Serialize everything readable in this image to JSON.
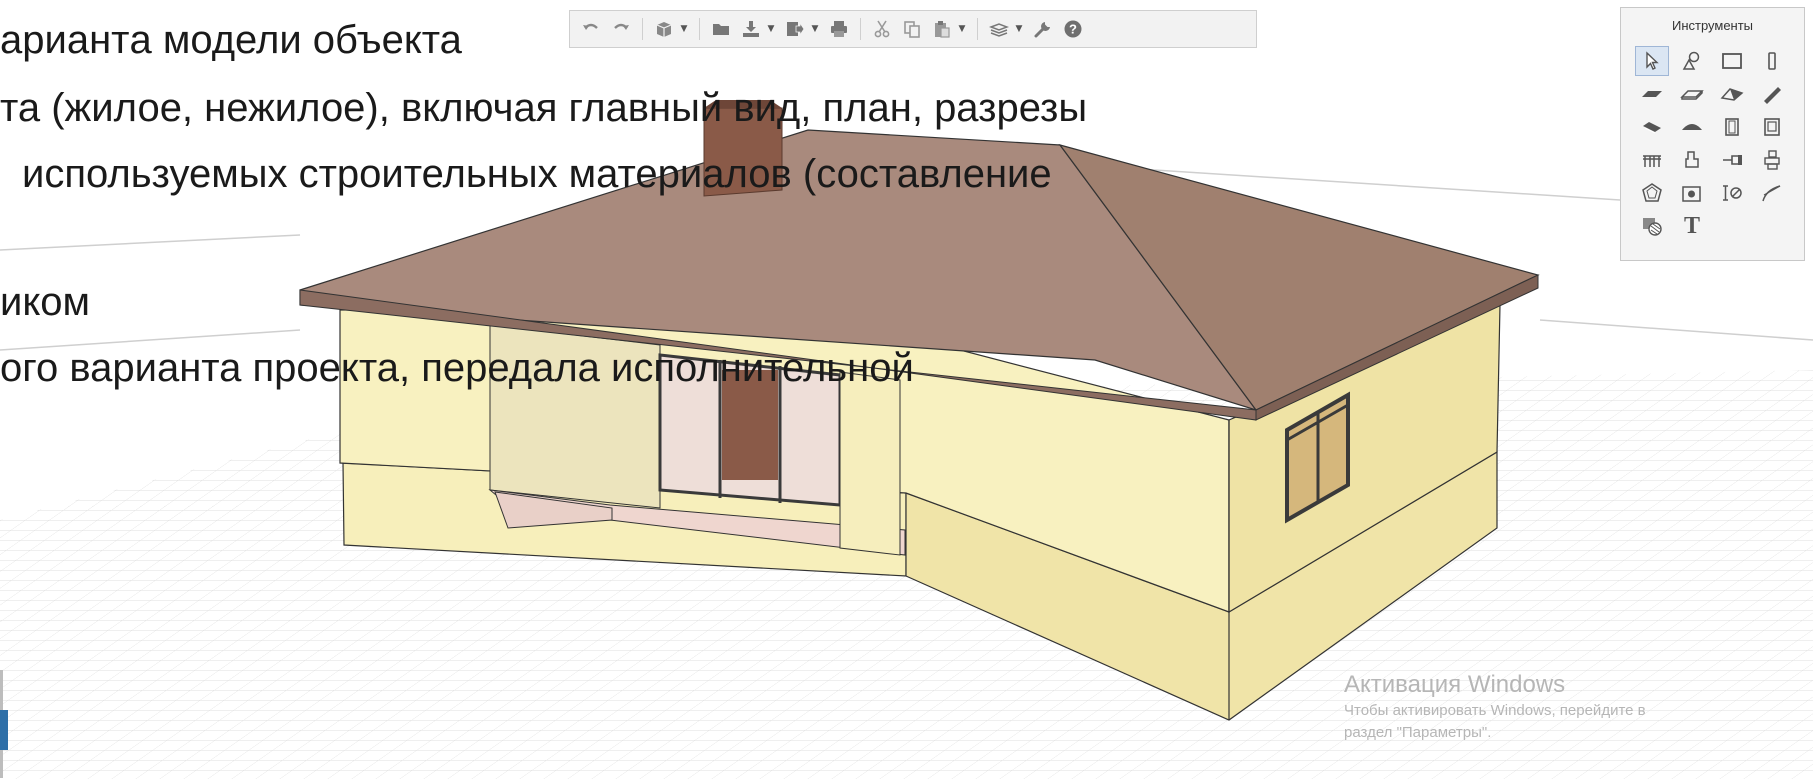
{
  "slide": {
    "lines": [
      "ариантa модели объекта",
      "та (жилое, нежилое), включая главный вид, план, разрезы",
      "используемых строительных материалов (составление",
      "",
      "иком",
      "ого варианта проекта, передала исполнительной"
    ]
  },
  "toolbar": {
    "buttons": [
      {
        "name": "undo-button",
        "icon": "undo-icon",
        "has_menu": false
      },
      {
        "name": "redo-button",
        "icon": "redo-icon",
        "has_menu": false
      },
      {
        "name": "3d-view-button",
        "icon": "cube-icon",
        "has_menu": true
      },
      {
        "name": "open-button",
        "icon": "folder-icon",
        "has_menu": false
      },
      {
        "name": "import-button",
        "icon": "import-icon",
        "has_menu": true
      },
      {
        "name": "export-button",
        "icon": "export-icon",
        "has_menu": true
      },
      {
        "name": "print-button",
        "icon": "printer-icon",
        "has_menu": false
      },
      {
        "name": "cut-button",
        "icon": "scissors-icon",
        "has_menu": false
      },
      {
        "name": "copy-button",
        "icon": "copy-icon",
        "has_menu": false
      },
      {
        "name": "paste-button",
        "icon": "paste-icon",
        "has_menu": true
      },
      {
        "name": "layers-button",
        "icon": "layers-icon",
        "has_menu": true
      },
      {
        "name": "settings-button",
        "icon": "wrench-icon",
        "has_menu": false
      },
      {
        "name": "help-button",
        "icon": "help-icon",
        "has_menu": false
      }
    ]
  },
  "palette": {
    "title": "Инструменты",
    "tools": [
      {
        "name": "arrow-tool",
        "icon": "cursor-arrow-icon",
        "selected": true
      },
      {
        "name": "object-tool",
        "icon": "object-icon"
      },
      {
        "name": "wall-tool",
        "icon": "wall-icon"
      },
      {
        "name": "column-tool",
        "icon": "column-icon"
      },
      {
        "name": "slab-tool",
        "icon": "slab-icon"
      },
      {
        "name": "floor-tool",
        "icon": "floor-icon"
      },
      {
        "name": "roof-tool",
        "icon": "roof-icon"
      },
      {
        "name": "beam-tool",
        "icon": "beam-icon"
      },
      {
        "name": "stair-tool",
        "icon": "stair-icon"
      },
      {
        "name": "shell-tool",
        "icon": "shell-icon"
      },
      {
        "name": "door-tool",
        "icon": "door-icon"
      },
      {
        "name": "window-tool",
        "icon": "window-icon"
      },
      {
        "name": "railing-tool",
        "icon": "railing-icon"
      },
      {
        "name": "fixture-tool",
        "icon": "fixture-icon"
      },
      {
        "name": "pipe-tool",
        "icon": "pipe-icon"
      },
      {
        "name": "equipment-tool",
        "icon": "equipment-icon"
      },
      {
        "name": "zone-tool",
        "icon": "zone-icon"
      },
      {
        "name": "camera-tool",
        "icon": "camera-icon"
      },
      {
        "name": "dimension-tool",
        "icon": "dimension-icon"
      },
      {
        "name": "line-tool",
        "icon": "line-icon"
      },
      {
        "name": "fill-tool",
        "icon": "fill-icon"
      },
      {
        "name": "text-tool",
        "icon": "text-icon",
        "glyph": "T"
      }
    ]
  },
  "watermark": {
    "title": "Активация Windows",
    "line1": "Чтобы активировать Windows, перейдите в",
    "line2": "раздел \"Параметры\"."
  },
  "colors": {
    "wall": "#f8f1c0",
    "wall_shadow": "#e8dda0",
    "roof": "#a8877a",
    "roof_dark": "#8c6d61",
    "chimney": "#8a5a48",
    "floor_pink": "#f0d8d0",
    "grid": "#e2e2e2",
    "toolbar_icon": "#555555"
  }
}
